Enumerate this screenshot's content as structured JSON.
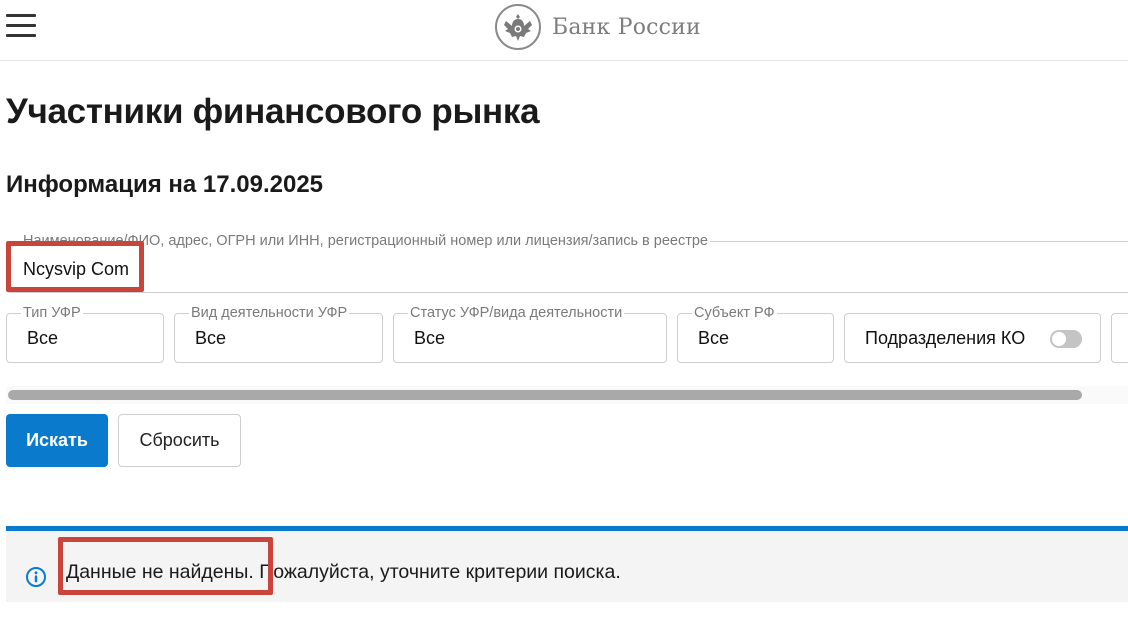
{
  "header": {
    "menu_icon": "hamburger-menu-icon",
    "logo_icon": "double-headed-eagle-emblem",
    "brand_name": "Банк России"
  },
  "page": {
    "title": "Участники финансового рынка",
    "info_date": "Информация на 17.09.2025"
  },
  "search": {
    "label": "Наименование/ФИО, адрес, ОГРН или ИНН, регистрационный номер или лицензия/запись в реестре",
    "value": "Ncysvip Com"
  },
  "filters": [
    {
      "label": "Тип УФР",
      "value": "Все"
    },
    {
      "label": "Вид деятельности УФР",
      "value": "Все"
    },
    {
      "label": "Статус УФР/вида деятельности",
      "value": "Все"
    },
    {
      "label": "Субъект РФ",
      "value": "Все"
    }
  ],
  "toggle": {
    "label": "Подразделения КО",
    "on": false
  },
  "buttons": {
    "search_label": "Искать",
    "reset_label": "Сбросить"
  },
  "result": {
    "icon": "info-circle-icon",
    "message": "Данные не найдены. Пожалуйста, уточните критерии поиска."
  },
  "colors": {
    "accent": "#0a7acc",
    "highlight": "#c9443a",
    "brand_gray": "#7d7d7d"
  }
}
